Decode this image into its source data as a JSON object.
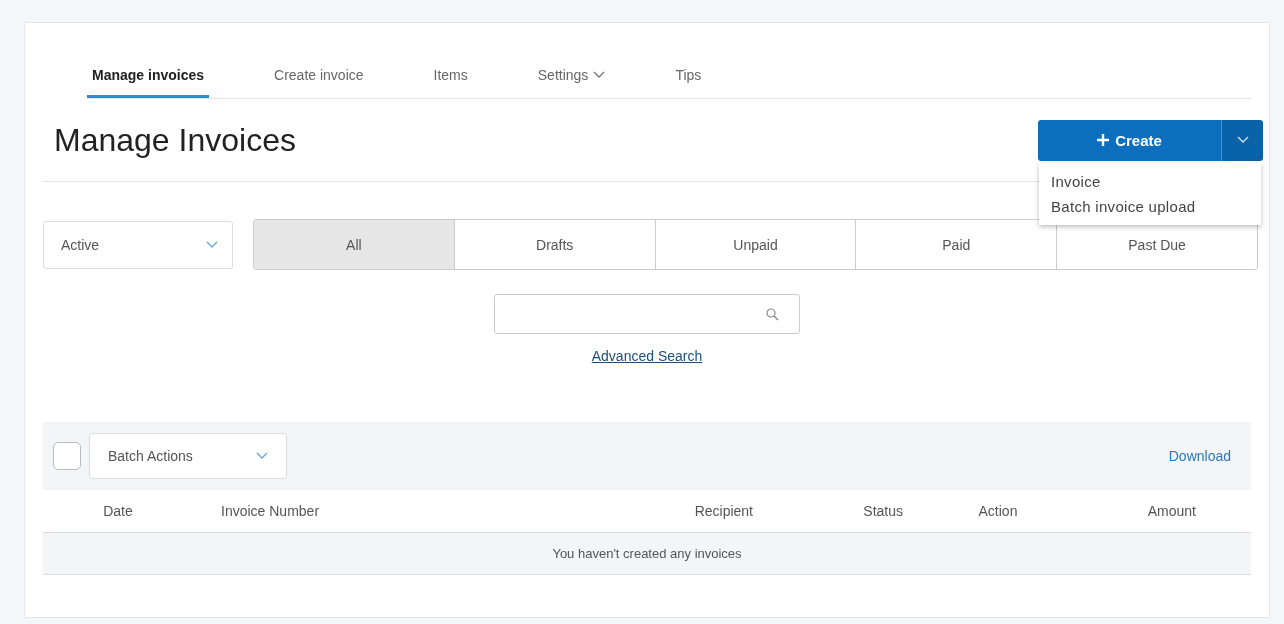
{
  "tabs": [
    {
      "label": "Manage invoices",
      "selected": true,
      "has_menu": false
    },
    {
      "label": "Create invoice",
      "selected": false,
      "has_menu": false
    },
    {
      "label": "Items",
      "selected": false,
      "has_menu": false
    },
    {
      "label": "Settings",
      "selected": false,
      "has_menu": true
    },
    {
      "label": "Tips",
      "selected": false,
      "has_menu": false
    }
  ],
  "page_title": "Manage Invoices",
  "create_button": {
    "label": "Create",
    "menu_expanded": true,
    "menu_items": [
      "Invoice",
      "Batch invoice upload"
    ]
  },
  "status_select": {
    "value": "Active"
  },
  "filters": [
    {
      "label": "All",
      "selected": true
    },
    {
      "label": "Drafts",
      "selected": false
    },
    {
      "label": "Unpaid",
      "selected": false
    },
    {
      "label": "Paid",
      "selected": false
    },
    {
      "label": "Past Due",
      "selected": false
    }
  ],
  "search": {
    "link": "Advanced Search"
  },
  "table": {
    "select_all_checked": false,
    "batch_actions": "Batch Actions",
    "download": "Download",
    "columns": [
      "Date",
      "Invoice Number",
      "Recipient",
      "Status",
      "Action",
      "Amount"
    ],
    "empty_message": "You haven't created any invoices"
  }
}
